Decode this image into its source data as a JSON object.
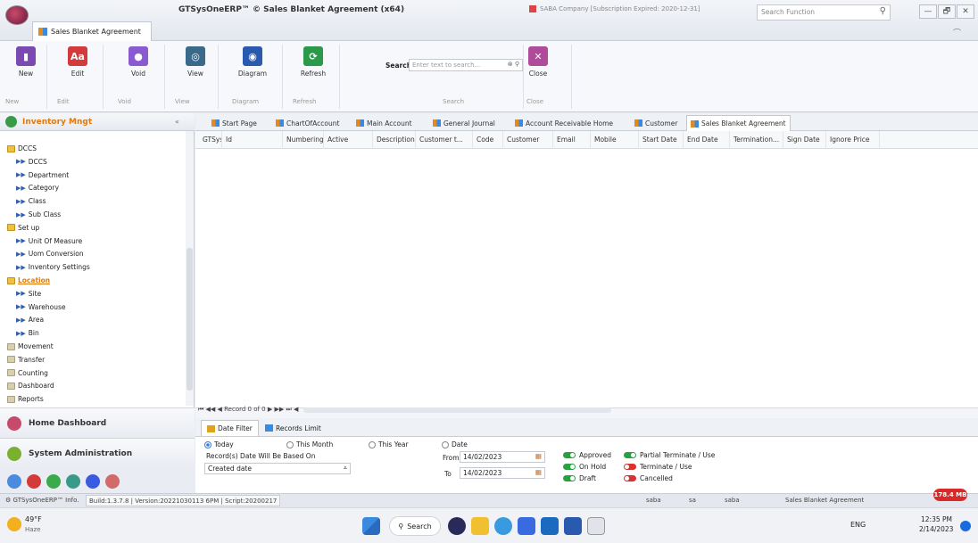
{
  "window": {
    "title": "GTSysOneERP™ © Sales Blanket Agreement (x64)",
    "doc_tab": "Sales Blanket Agreement",
    "company": "SABA Company [Subscription Expired: 2020-12-31]",
    "search_function_placeholder": "Search Function",
    "min": "—",
    "max": "🗗",
    "close": "✕"
  },
  "ribbon": {
    "new": "New",
    "edit": "Edit",
    "void": "Void",
    "view": "View",
    "diagram": "Diagram",
    "refresh": "Refresh",
    "close": "Close",
    "search_label": "Search",
    "search_placeholder": "Enter text to search...",
    "groups": {
      "new": "New",
      "edit": "Edit",
      "void": "Void",
      "view": "View",
      "diagram": "Diagram",
      "refresh": "Refresh",
      "search": "Search",
      "close": "Close"
    }
  },
  "sidebar": {
    "title": "Inventory Mngt",
    "collapse": "«",
    "items": [
      {
        "label": "DCCS",
        "type": "folder"
      },
      {
        "label": "DCCS",
        "type": "leaf"
      },
      {
        "label": "Department",
        "type": "leaf"
      },
      {
        "label": "Category",
        "type": "leaf"
      },
      {
        "label": "Class",
        "type": "leaf"
      },
      {
        "label": "Sub Class",
        "type": "leaf"
      },
      {
        "label": "Set up",
        "type": "folder"
      },
      {
        "label": "Unit Of Measure",
        "type": "leaf"
      },
      {
        "label": "Uom Conversion",
        "type": "leaf"
      },
      {
        "label": "Inventory Settings",
        "type": "leaf"
      },
      {
        "label": "Location",
        "type": "folder"
      },
      {
        "label": "Site",
        "type": "leaf"
      },
      {
        "label": "Warehouse",
        "type": "leaf"
      },
      {
        "label": "Area",
        "type": "leaf"
      },
      {
        "label": "Bin",
        "type": "leaf"
      },
      {
        "label": "Movement",
        "type": "gfolder"
      },
      {
        "label": "Transfer",
        "type": "gfolder"
      },
      {
        "label": "Counting",
        "type": "gfolder"
      },
      {
        "label": "Dashboard",
        "type": "gfolder"
      },
      {
        "label": "Reports",
        "type": "gfolder"
      }
    ],
    "home_dashboard": "Home Dashboard",
    "system_administration": "System Administration"
  },
  "tabs": [
    "Start Page",
    "ChartOfAccount",
    "Main Account",
    "General Journal",
    "Account Receivable Home",
    "Customer",
    "Sales Blanket Agreement"
  ],
  "grid": {
    "columns": [
      "GTSys",
      "Id",
      "Numbering",
      "Active",
      "Description",
      "Customer t...",
      "Code",
      "Customer",
      "Email",
      "Mobile",
      "Start Date",
      "End Date",
      "Termination...",
      "Sign Date",
      "Ignore Price"
    ],
    "pager": "⏮ ◀◀ ◀ Record 0 of 0 ▶ ▶▶ ⏭ ◀"
  },
  "filter": {
    "tabs": [
      "Date Filter",
      "Records Limit"
    ],
    "today": "Today",
    "this_month": "This Month",
    "this_year": "This Year",
    "date": "Date",
    "based_on_label": "Record(s) Date  Will Be Based On",
    "based_on_value": "Created date",
    "from_label": "From",
    "from_value": "14/02/2023",
    "to_label": "To",
    "to_value": "14/02/2023",
    "approved": "Approved",
    "on_hold": "On Hold",
    "draft": "Draft",
    "partial_terminate": "Partial Terminate / Use",
    "terminate": "Terminate / Use",
    "cancelled": "Cancelled"
  },
  "status": {
    "info": "GTSysOneERP™ Info.",
    "build": "Build:1.3.7.8 | Version:20221030113 6PM | Script:20200217",
    "users": [
      "saba",
      "sa",
      "saba"
    ],
    "current": "Sales Blanket Agreement",
    "memory": "178.4 MB"
  },
  "taskbar": {
    "weather_temp": "49°F",
    "weather_desc": "Haze",
    "search": "Search",
    "lang": "ENG",
    "time": "12:35 PM",
    "date": "2/14/2023"
  }
}
